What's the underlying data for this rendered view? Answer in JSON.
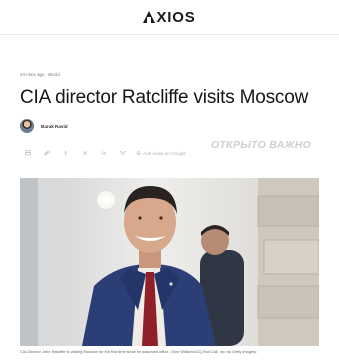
{
  "header": {
    "logo_text": "XIOS"
  },
  "meta": {
    "time": "24 mins ago",
    "section": "World"
  },
  "article": {
    "headline": "CIA director Ratcliffe visits Moscow",
    "author": "Barak Ravid",
    "caption": "CIA Director John Ratcliffe is visiting Moscow for the first time since he assumed office. (Tom Williams/CQ-Roll Call, Inc via Getty Images)"
  },
  "share": {
    "add_google_label": "Add Axios on Google"
  },
  "watermark": {
    "text": "ОТКРЫТО ВАЖНО"
  },
  "icons": [
    "print-icon",
    "link-icon",
    "facebook-icon",
    "x-icon",
    "linkedin-icon",
    "bluesky-icon",
    "google-plus-icon"
  ]
}
